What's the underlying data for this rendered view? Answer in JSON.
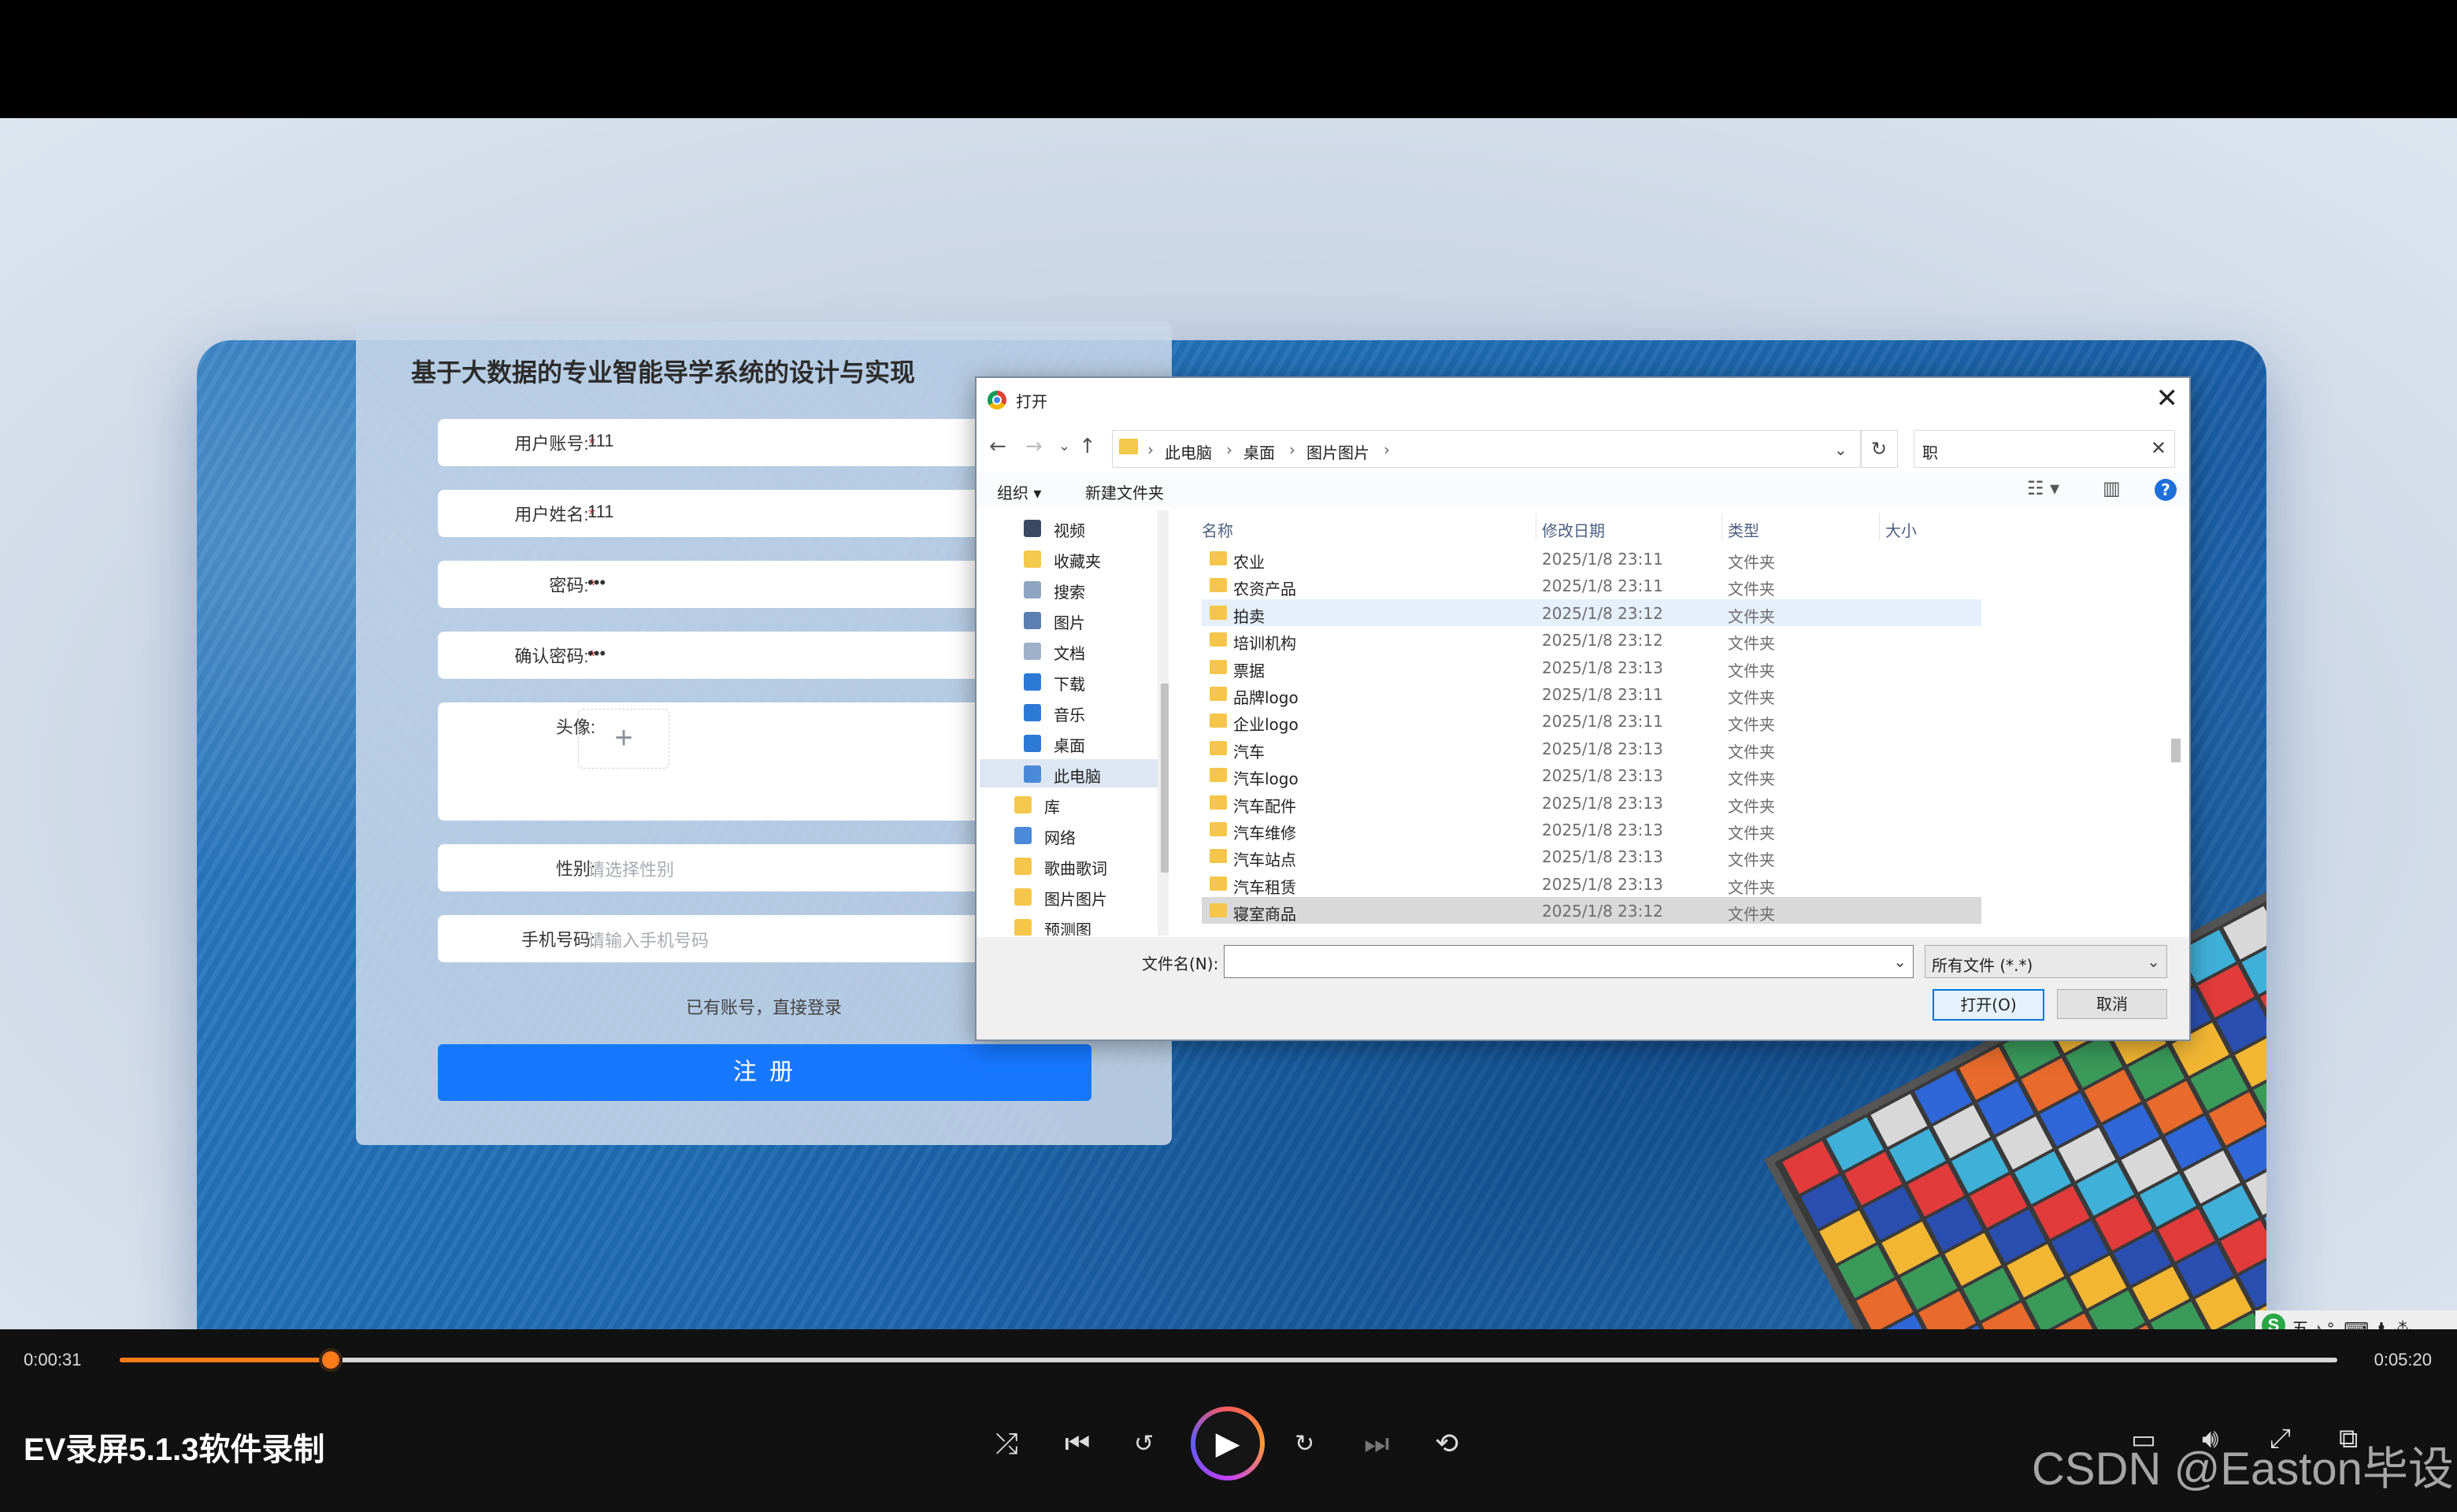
{
  "form": {
    "title": "基于大数据的专业智能导学系统的设计与实现",
    "fields": [
      {
        "label": "用户账号:",
        "required": true,
        "value": "111",
        "placeholder": ""
      },
      {
        "label": "用户姓名:",
        "required": true,
        "value": "111",
        "placeholder": ""
      },
      {
        "label": "密码:",
        "required": true,
        "value": "•••",
        "placeholder": ""
      },
      {
        "label": "确认密码:",
        "required": true,
        "value": "•••",
        "placeholder": ""
      }
    ],
    "avatar_label": "头像:",
    "avatar_add_icon": "+",
    "gender_label": "性别:",
    "gender_placeholder": "请选择性别",
    "phone_label": "手机号码:",
    "phone_placeholder": "请输入手机号码",
    "required_mark": "*",
    "login_link": "已有账号，直接登录",
    "register_button": "注 册"
  },
  "dialog": {
    "title": "打开",
    "close": "✕",
    "breadcrumb": [
      "此电脑",
      "桌面",
      "图片图片"
    ],
    "search_value": "职",
    "toolbar": {
      "organize": "组织 ▾",
      "new_folder": "新建文件夹"
    },
    "nav_items": [
      {
        "label": "视频",
        "icon": "video-icon",
        "color": "#3b4a63"
      },
      {
        "label": "收藏夹",
        "icon": "star-icon",
        "color": "#f2c94c"
      },
      {
        "label": "搜索",
        "icon": "search-icon",
        "color": "#8fa6c2"
      },
      {
        "label": "图片",
        "icon": "picture-icon",
        "color": "#5a7fb0"
      },
      {
        "label": "文档",
        "icon": "document-icon",
        "color": "#9fb1c8"
      },
      {
        "label": "下载",
        "icon": "download-icon",
        "color": "#2d7ad6"
      },
      {
        "label": "音乐",
        "icon": "music-icon",
        "color": "#2d7ad6"
      },
      {
        "label": "桌面",
        "icon": "desktop-icon",
        "color": "#2d7ad6"
      },
      {
        "label": "此电脑",
        "icon": "computer-icon",
        "color": "#4a8ad8"
      },
      {
        "label": "库",
        "icon": "library-icon",
        "color": "#f2c94c"
      },
      {
        "label": "网络",
        "icon": "network-icon",
        "color": "#4a8ad8"
      },
      {
        "label": "歌曲歌词",
        "icon": "folder-icon",
        "color": "#f5c64a"
      },
      {
        "label": "图片图片",
        "icon": "folder-icon",
        "color": "#f5c64a"
      },
      {
        "label": "预测图",
        "icon": "folder-icon",
        "color": "#f5c64a"
      }
    ],
    "columns": {
      "name": "名称",
      "date": "修改日期",
      "type": "类型",
      "size": "大小"
    },
    "files": [
      {
        "name": "农业",
        "date": "2025/1/8 23:11",
        "type": "文件夹"
      },
      {
        "name": "农资产品",
        "date": "2025/1/8 23:11",
        "type": "文件夹"
      },
      {
        "name": "拍卖",
        "date": "2025/1/8 23:12",
        "type": "文件夹"
      },
      {
        "name": "培训机构",
        "date": "2025/1/8 23:12",
        "type": "文件夹"
      },
      {
        "name": "票据",
        "date": "2025/1/8 23:13",
        "type": "文件夹"
      },
      {
        "name": "品牌logo",
        "date": "2025/1/8 23:11",
        "type": "文件夹"
      },
      {
        "name": "企业logo",
        "date": "2025/1/8 23:11",
        "type": "文件夹"
      },
      {
        "name": "汽车",
        "date": "2025/1/8 23:13",
        "type": "文件夹"
      },
      {
        "name": "汽车logo",
        "date": "2025/1/8 23:13",
        "type": "文件夹"
      },
      {
        "name": "汽车配件",
        "date": "2025/1/8 23:13",
        "type": "文件夹"
      },
      {
        "name": "汽车维修",
        "date": "2025/1/8 23:13",
        "type": "文件夹"
      },
      {
        "name": "汽车站点",
        "date": "2025/1/8 23:13",
        "type": "文件夹"
      },
      {
        "name": "汽车租赁",
        "date": "2025/1/8 23:13",
        "type": "文件夹"
      },
      {
        "name": "寝室商品",
        "date": "2025/1/8 23:12",
        "type": "文件夹"
      }
    ],
    "filename_label": "文件名(N):",
    "filename_value": "",
    "filter_value": "所有文件 (*.*)",
    "open_button": "打开(O)",
    "cancel_button": "取消"
  },
  "player": {
    "current_time": "0:00:31",
    "total_time": "0:05:20",
    "progress": 0.095,
    "title": "EV录屏5.1.3软件录制",
    "accent": "#ff7a1a",
    "ime_text": "五 ♪ °, ⌨ ♟ ⁂",
    "watermark": "CSDN @Easton毕设"
  }
}
